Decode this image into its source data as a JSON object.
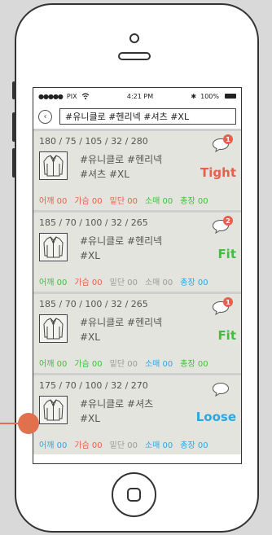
{
  "status_bar": {
    "carrier": "PIX",
    "time": "4:21 PM",
    "battery": "100%"
  },
  "search": {
    "query": "#유니클로 #헨리넥 #셔츠 #XL"
  },
  "items": [
    {
      "measure": "180 / 75 / 105 / 32 / 280",
      "tags": [
        "#유니클로 #헨리넥",
        "#셔츠 #XL"
      ],
      "badge": "1",
      "fit": "Tight",
      "fit_color": "#e8604c",
      "dims": [
        "어깨 00",
        "가슴 00",
        "밑단 00",
        "소매 00",
        "총장 00"
      ],
      "dim_colors": [
        "#e8604c",
        "#e8604c",
        "#e8604c",
        "#3fbf3f",
        "#3fbf3f"
      ]
    },
    {
      "measure": "185 / 70 / 100 / 32 / 265",
      "tags": [
        "#유니클로 #헨리넥",
        "#XL"
      ],
      "badge": "2",
      "fit": "Fit",
      "fit_color": "#3fbf3f",
      "dims": [
        "어깨 00",
        "가슴 00",
        "밑단 00",
        "소매 00",
        "총장 00"
      ],
      "dim_colors": [
        "#3fbf3f",
        "#e8604c",
        "#999999",
        "#999999",
        "#29a8e0"
      ]
    },
    {
      "measure": "185 / 70 / 100 / 32 / 265",
      "tags": [
        "#유니클로 #헨리넥",
        "#XL"
      ],
      "badge": "1",
      "fit": "Fit",
      "fit_color": "#3fbf3f",
      "dims": [
        "어깨 00",
        "가슴 00",
        "밑단 00",
        "소매 00",
        "총장 00"
      ],
      "dim_colors": [
        "#3fbf3f",
        "#3fbf3f",
        "#999999",
        "#29a8e0",
        "#3fbf3f"
      ]
    },
    {
      "measure": "175 / 70 / 100 / 32 / 270",
      "tags": [
        "#유니클로 #셔츠",
        "#XL"
      ],
      "badge": "",
      "fit": "Loose",
      "fit_color": "#29a8e0",
      "dims": [
        "어깨 00",
        "가슴 00",
        "밑단 00",
        "소매 00",
        "총장 00"
      ],
      "dim_colors": [
        "#29a8e0",
        "#e8604c",
        "#999999",
        "#29a8e0",
        "#29a8e0"
      ]
    }
  ],
  "icons": {
    "back": "back-circle-icon",
    "comment": "speech-bubble-icon",
    "thumbnail": "jacket-icon",
    "home": "home-button-icon",
    "wifi": "wifi-icon",
    "bluetooth": "bluetooth-icon"
  }
}
